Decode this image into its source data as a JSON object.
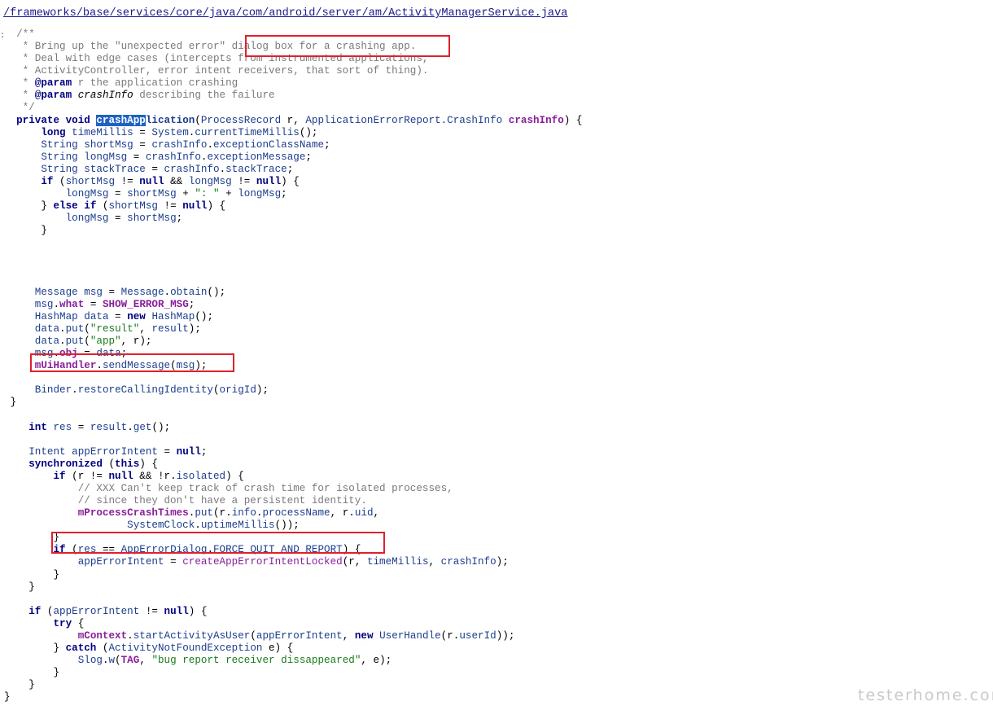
{
  "file_path": "/frameworks/base/services/core/java/com/android/server/am/ActivityManagerService.java",
  "gutter_mark": ":",
  "watermark": "testerhome.com",
  "colors": {
    "highlight_box": "#e0202b",
    "selection": "#1f62c2",
    "keyword": "#000080",
    "identifier": "#1c3d8c",
    "member": "#8a1e9a",
    "string": "#1a7a1a",
    "comment": "#7a7a7a"
  },
  "code_lines": [
    {
      "tokens": [
        {
          "t": "  /**",
          "c": "cm"
        }
      ]
    },
    {
      "tokens": [
        {
          "t": "   * Bring up the \"unexpected error\" dialog box for a crashing app.",
          "c": "cm"
        }
      ]
    },
    {
      "tokens": [
        {
          "t": "   * Deal with edge cases (intercepts from instrumented applications,",
          "c": "cm"
        }
      ]
    },
    {
      "tokens": [
        {
          "t": "   * ActivityController, error intent receivers, that sort of thing).",
          "c": "cm"
        }
      ]
    },
    {
      "tokens": [
        {
          "t": "   * ",
          "c": "cm"
        },
        {
          "t": "@param",
          "c": "kw"
        },
        {
          "t": " r the application crashing",
          "c": "cm"
        }
      ]
    },
    {
      "tokens": [
        {
          "t": "   * ",
          "c": "cm"
        },
        {
          "t": "@param",
          "c": "kw"
        },
        {
          "t": " ",
          "c": "cm"
        },
        {
          "t": "crashInfo",
          "c": "par"
        },
        {
          "t": " describing the failure",
          "c": "cm"
        }
      ]
    },
    {
      "tokens": [
        {
          "t": "   */",
          "c": "cm"
        }
      ]
    },
    {
      "tokens": [
        {
          "t": "  private void ",
          "c": "kw"
        },
        {
          "t": "crashApp",
          "c": "sel"
        },
        {
          "t": "lication",
          "c": "idb"
        },
        {
          "t": "(",
          "c": "pl"
        },
        {
          "t": "ProcessRecord",
          "c": "id"
        },
        {
          "t": " r, ",
          "c": "pl"
        },
        {
          "t": "ApplicationErrorReport.CrashInfo",
          "c": "id"
        },
        {
          "t": " ",
          "c": "pl"
        },
        {
          "t": "crashInfo",
          "c": "memb"
        },
        {
          "t": ") {",
          "c": "pl"
        }
      ]
    },
    {
      "tokens": [
        {
          "t": "      long ",
          "c": "kw"
        },
        {
          "t": "timeMillis",
          "c": "id"
        },
        {
          "t": " = ",
          "c": "pl"
        },
        {
          "t": "System",
          "c": "id"
        },
        {
          "t": ".",
          "c": "pl"
        },
        {
          "t": "currentTimeMillis",
          "c": "id"
        },
        {
          "t": "();",
          "c": "pl"
        }
      ]
    },
    {
      "tokens": [
        {
          "t": "      ",
          "c": "pl"
        },
        {
          "t": "String",
          "c": "id"
        },
        {
          "t": " ",
          "c": "pl"
        },
        {
          "t": "shortMsg",
          "c": "id"
        },
        {
          "t": " = ",
          "c": "pl"
        },
        {
          "t": "crashInfo",
          "c": "id"
        },
        {
          "t": ".",
          "c": "pl"
        },
        {
          "t": "exceptionClassName",
          "c": "id"
        },
        {
          "t": ";",
          "c": "pl"
        }
      ]
    },
    {
      "tokens": [
        {
          "t": "      ",
          "c": "pl"
        },
        {
          "t": "String",
          "c": "id"
        },
        {
          "t": " ",
          "c": "pl"
        },
        {
          "t": "longMsg",
          "c": "id"
        },
        {
          "t": " = ",
          "c": "pl"
        },
        {
          "t": "crashInfo",
          "c": "id"
        },
        {
          "t": ".",
          "c": "pl"
        },
        {
          "t": "exceptionMessage",
          "c": "id"
        },
        {
          "t": ";",
          "c": "pl"
        }
      ]
    },
    {
      "tokens": [
        {
          "t": "      ",
          "c": "pl"
        },
        {
          "t": "String",
          "c": "id"
        },
        {
          "t": " ",
          "c": "pl"
        },
        {
          "t": "stackTrace",
          "c": "id"
        },
        {
          "t": " = ",
          "c": "pl"
        },
        {
          "t": "crashInfo",
          "c": "id"
        },
        {
          "t": ".",
          "c": "pl"
        },
        {
          "t": "stackTrace",
          "c": "id"
        },
        {
          "t": ";",
          "c": "pl"
        }
      ]
    },
    {
      "tokens": [
        {
          "t": "      if ",
          "c": "kw"
        },
        {
          "t": "(",
          "c": "pl"
        },
        {
          "t": "shortMsg",
          "c": "id"
        },
        {
          "t": " != ",
          "c": "pl"
        },
        {
          "t": "null",
          "c": "kw"
        },
        {
          "t": " && ",
          "c": "pl"
        },
        {
          "t": "longMsg",
          "c": "id"
        },
        {
          "t": " != ",
          "c": "pl"
        },
        {
          "t": "null",
          "c": "kw"
        },
        {
          "t": ") {",
          "c": "pl"
        }
      ]
    },
    {
      "tokens": [
        {
          "t": "          ",
          "c": "pl"
        },
        {
          "t": "longMsg",
          "c": "id"
        },
        {
          "t": " = ",
          "c": "pl"
        },
        {
          "t": "shortMsg",
          "c": "id"
        },
        {
          "t": " + ",
          "c": "pl"
        },
        {
          "t": "\": \"",
          "c": "str"
        },
        {
          "t": " + ",
          "c": "pl"
        },
        {
          "t": "longMsg",
          "c": "id"
        },
        {
          "t": ";",
          "c": "pl"
        }
      ]
    },
    {
      "tokens": [
        {
          "t": "      } ",
          "c": "pl"
        },
        {
          "t": "else if",
          "c": "kw"
        },
        {
          "t": " (",
          "c": "pl"
        },
        {
          "t": "shortMsg",
          "c": "id"
        },
        {
          "t": " != ",
          "c": "pl"
        },
        {
          "t": "null",
          "c": "kw"
        },
        {
          "t": ") {",
          "c": "pl"
        }
      ]
    },
    {
      "tokens": [
        {
          "t": "          ",
          "c": "pl"
        },
        {
          "t": "longMsg",
          "c": "id"
        },
        {
          "t": " = ",
          "c": "pl"
        },
        {
          "t": "shortMsg",
          "c": "id"
        },
        {
          "t": ";",
          "c": "pl"
        }
      ]
    },
    {
      "tokens": [
        {
          "t": "      }",
          "c": "pl"
        }
      ]
    },
    {
      "tokens": []
    },
    {
      "tokens": []
    },
    {
      "tokens": []
    },
    {
      "tokens": []
    },
    {
      "tokens": [
        {
          "t": "     ",
          "c": "pl"
        },
        {
          "t": "Message",
          "c": "id"
        },
        {
          "t": " ",
          "c": "pl"
        },
        {
          "t": "msg",
          "c": "id"
        },
        {
          "t": " = ",
          "c": "pl"
        },
        {
          "t": "Message",
          "c": "id"
        },
        {
          "t": ".",
          "c": "pl"
        },
        {
          "t": "obtain",
          "c": "id"
        },
        {
          "t": "();",
          "c": "pl"
        }
      ]
    },
    {
      "tokens": [
        {
          "t": "     ",
          "c": "pl"
        },
        {
          "t": "msg",
          "c": "id"
        },
        {
          "t": ".",
          "c": "pl"
        },
        {
          "t": "what",
          "c": "memb"
        },
        {
          "t": " = ",
          "c": "pl"
        },
        {
          "t": "SHOW_ERROR_MSG",
          "c": "memb"
        },
        {
          "t": ";",
          "c": "pl"
        }
      ]
    },
    {
      "tokens": [
        {
          "t": "     ",
          "c": "pl"
        },
        {
          "t": "HashMap",
          "c": "id"
        },
        {
          "t": " ",
          "c": "pl"
        },
        {
          "t": "data",
          "c": "id"
        },
        {
          "t": " = ",
          "c": "pl"
        },
        {
          "t": "new",
          "c": "kw"
        },
        {
          "t": " ",
          "c": "pl"
        },
        {
          "t": "HashMap",
          "c": "id"
        },
        {
          "t": "();",
          "c": "pl"
        }
      ]
    },
    {
      "tokens": [
        {
          "t": "     ",
          "c": "pl"
        },
        {
          "t": "data",
          "c": "id"
        },
        {
          "t": ".",
          "c": "pl"
        },
        {
          "t": "put",
          "c": "id"
        },
        {
          "t": "(",
          "c": "pl"
        },
        {
          "t": "\"result\"",
          "c": "str"
        },
        {
          "t": ", ",
          "c": "pl"
        },
        {
          "t": "result",
          "c": "id"
        },
        {
          "t": ");",
          "c": "pl"
        }
      ]
    },
    {
      "tokens": [
        {
          "t": "     ",
          "c": "pl"
        },
        {
          "t": "data",
          "c": "id"
        },
        {
          "t": ".",
          "c": "pl"
        },
        {
          "t": "put",
          "c": "id"
        },
        {
          "t": "(",
          "c": "pl"
        },
        {
          "t": "\"app\"",
          "c": "str"
        },
        {
          "t": ", r);",
          "c": "pl"
        }
      ]
    },
    {
      "tokens": [
        {
          "t": "     ",
          "c": "pl"
        },
        {
          "t": "msg",
          "c": "id"
        },
        {
          "t": ".",
          "c": "pl"
        },
        {
          "t": "obj",
          "c": "memb"
        },
        {
          "t": " = ",
          "c": "pl"
        },
        {
          "t": "data",
          "c": "id"
        },
        {
          "t": ";",
          "c": "pl"
        }
      ]
    },
    {
      "tokens": [
        {
          "t": "     ",
          "c": "pl"
        },
        {
          "t": "mUiHandler",
          "c": "memb"
        },
        {
          "t": ".",
          "c": "pl"
        },
        {
          "t": "sendMessage",
          "c": "id"
        },
        {
          "t": "(",
          "c": "pl"
        },
        {
          "t": "msg",
          "c": "id"
        },
        {
          "t": ");",
          "c": "pl"
        }
      ]
    },
    {
      "tokens": []
    },
    {
      "tokens": [
        {
          "t": "     ",
          "c": "pl"
        },
        {
          "t": "Binder",
          "c": "id"
        },
        {
          "t": ".",
          "c": "pl"
        },
        {
          "t": "restoreCallingIdentity",
          "c": "id"
        },
        {
          "t": "(",
          "c": "pl"
        },
        {
          "t": "origId",
          "c": "id"
        },
        {
          "t": ");",
          "c": "pl"
        }
      ]
    },
    {
      "tokens": [
        {
          "t": " }",
          "c": "pl"
        }
      ]
    },
    {
      "tokens": []
    },
    {
      "tokens": [
        {
          "t": "    int ",
          "c": "kw"
        },
        {
          "t": "res",
          "c": "id"
        },
        {
          "t": " = ",
          "c": "pl"
        },
        {
          "t": "result",
          "c": "id"
        },
        {
          "t": ".",
          "c": "pl"
        },
        {
          "t": "get",
          "c": "id"
        },
        {
          "t": "();",
          "c": "pl"
        }
      ]
    },
    {
      "tokens": []
    },
    {
      "tokens": [
        {
          "t": "    ",
          "c": "pl"
        },
        {
          "t": "Intent",
          "c": "id"
        },
        {
          "t": " ",
          "c": "pl"
        },
        {
          "t": "appErrorIntent",
          "c": "id"
        },
        {
          "t": " = ",
          "c": "pl"
        },
        {
          "t": "null",
          "c": "kw"
        },
        {
          "t": ";",
          "c": "pl"
        }
      ]
    },
    {
      "tokens": [
        {
          "t": "    synchronized",
          "c": "kw"
        },
        {
          "t": " (",
          "c": "pl"
        },
        {
          "t": "this",
          "c": "kw"
        },
        {
          "t": ") {",
          "c": "pl"
        }
      ]
    },
    {
      "tokens": [
        {
          "t": "        if",
          "c": "kw"
        },
        {
          "t": " (r != ",
          "c": "pl"
        },
        {
          "t": "null",
          "c": "kw"
        },
        {
          "t": " && !r.",
          "c": "pl"
        },
        {
          "t": "isolated",
          "c": "id"
        },
        {
          "t": ") {",
          "c": "pl"
        }
      ]
    },
    {
      "tokens": [
        {
          "t": "            // XXX Can't keep track of crash time for isolated processes,",
          "c": "cm"
        }
      ]
    },
    {
      "tokens": [
        {
          "t": "            // since they don't have a persistent identity.",
          "c": "cm"
        }
      ]
    },
    {
      "tokens": [
        {
          "t": "            ",
          "c": "pl"
        },
        {
          "t": "mProcessCrashTimes",
          "c": "memb"
        },
        {
          "t": ".",
          "c": "pl"
        },
        {
          "t": "put",
          "c": "id"
        },
        {
          "t": "(r.",
          "c": "pl"
        },
        {
          "t": "info",
          "c": "id"
        },
        {
          "t": ".",
          "c": "pl"
        },
        {
          "t": "processName",
          "c": "id"
        },
        {
          "t": ", r.",
          "c": "pl"
        },
        {
          "t": "uid",
          "c": "id"
        },
        {
          "t": ",",
          "c": "pl"
        }
      ]
    },
    {
      "tokens": [
        {
          "t": "                    ",
          "c": "pl"
        },
        {
          "t": "SystemClock",
          "c": "id"
        },
        {
          "t": ".",
          "c": "pl"
        },
        {
          "t": "uptimeMillis",
          "c": "id"
        },
        {
          "t": "());",
          "c": "pl"
        }
      ]
    },
    {
      "tokens": [
        {
          "t": "        }",
          "c": "pl"
        }
      ]
    },
    {
      "tokens": [
        {
          "t": "        if",
          "c": "kw"
        },
        {
          "t": " (",
          "c": "pl"
        },
        {
          "t": "res",
          "c": "id"
        },
        {
          "t": " == ",
          "c": "pl"
        },
        {
          "t": "AppErrorDialog",
          "c": "id"
        },
        {
          "t": ".",
          "c": "pl"
        },
        {
          "t": "FORCE_QUIT_AND_REPORT",
          "c": "id"
        },
        {
          "t": ") {",
          "c": "pl"
        }
      ]
    },
    {
      "tokens": [
        {
          "t": "            ",
          "c": "pl"
        },
        {
          "t": "appErrorIntent",
          "c": "id"
        },
        {
          "t": " = ",
          "c": "pl"
        },
        {
          "t": "createAppErrorIntentLocked",
          "c": "mem"
        },
        {
          "t": "(r, ",
          "c": "pl"
        },
        {
          "t": "timeMillis",
          "c": "id"
        },
        {
          "t": ", ",
          "c": "pl"
        },
        {
          "t": "crashInfo",
          "c": "id"
        },
        {
          "t": ");",
          "c": "pl"
        }
      ]
    },
    {
      "tokens": [
        {
          "t": "        }",
          "c": "pl"
        }
      ]
    },
    {
      "tokens": [
        {
          "t": "    }",
          "c": "pl"
        }
      ]
    },
    {
      "tokens": []
    },
    {
      "tokens": [
        {
          "t": "    if",
          "c": "kw"
        },
        {
          "t": " (",
          "c": "pl"
        },
        {
          "t": "appErrorIntent",
          "c": "id"
        },
        {
          "t": " != ",
          "c": "pl"
        },
        {
          "t": "null",
          "c": "kw"
        },
        {
          "t": ") {",
          "c": "pl"
        }
      ]
    },
    {
      "tokens": [
        {
          "t": "        try",
          "c": "kw"
        },
        {
          "t": " {",
          "c": "pl"
        }
      ]
    },
    {
      "tokens": [
        {
          "t": "            ",
          "c": "pl"
        },
        {
          "t": "mContext",
          "c": "memb"
        },
        {
          "t": ".",
          "c": "pl"
        },
        {
          "t": "startActivityAsUser",
          "c": "id"
        },
        {
          "t": "(",
          "c": "pl"
        },
        {
          "t": "appErrorIntent",
          "c": "id"
        },
        {
          "t": ", ",
          "c": "pl"
        },
        {
          "t": "new",
          "c": "kw"
        },
        {
          "t": " ",
          "c": "pl"
        },
        {
          "t": "UserHandle",
          "c": "id"
        },
        {
          "t": "(r.",
          "c": "pl"
        },
        {
          "t": "userId",
          "c": "id"
        },
        {
          "t": "));",
          "c": "pl"
        }
      ]
    },
    {
      "tokens": [
        {
          "t": "        } ",
          "c": "pl"
        },
        {
          "t": "catch",
          "c": "kw"
        },
        {
          "t": " (",
          "c": "pl"
        },
        {
          "t": "ActivityNotFoundException",
          "c": "id"
        },
        {
          "t": " e) {",
          "c": "pl"
        }
      ]
    },
    {
      "tokens": [
        {
          "t": "            ",
          "c": "pl"
        },
        {
          "t": "Slog",
          "c": "id"
        },
        {
          "t": ".",
          "c": "pl"
        },
        {
          "t": "w",
          "c": "id"
        },
        {
          "t": "(",
          "c": "pl"
        },
        {
          "t": "TAG",
          "c": "memb"
        },
        {
          "t": ", ",
          "c": "pl"
        },
        {
          "t": "\"bug report receiver dissappeared\"",
          "c": "str"
        },
        {
          "t": ", e);",
          "c": "pl"
        }
      ]
    },
    {
      "tokens": [
        {
          "t": "        }",
          "c": "pl"
        }
      ]
    },
    {
      "tokens": [
        {
          "t": "    }",
          "c": "pl"
        }
      ]
    },
    {
      "tokens": [
        {
          "t": "}",
          "c": "pl"
        }
      ]
    }
  ]
}
